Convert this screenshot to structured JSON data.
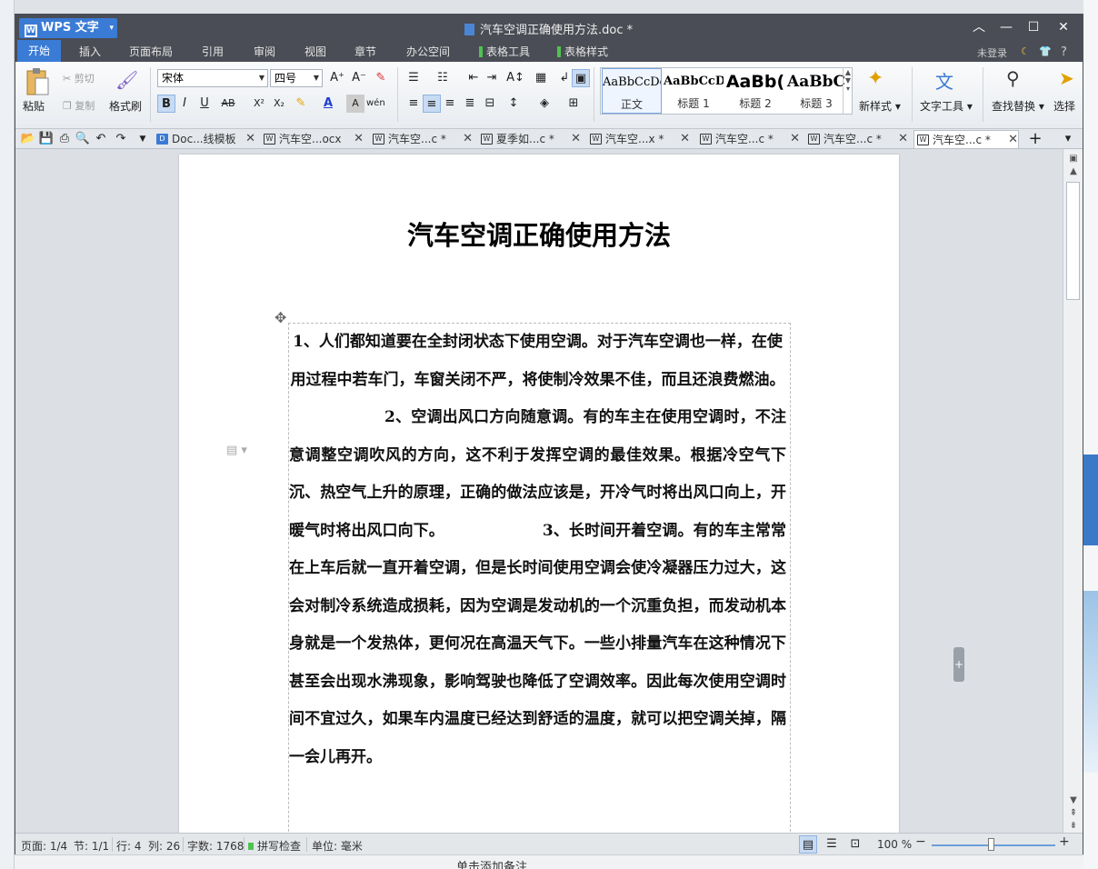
{
  "app": {
    "name": "WPS 文字",
    "doc_title": "汽车空调正确使用方法.doc *"
  },
  "menu": {
    "items": [
      "开始",
      "插入",
      "页面布局",
      "引用",
      "审阅",
      "视图",
      "章节",
      "办公空间"
    ],
    "context_items": [
      "表格工具",
      "表格样式"
    ],
    "login": "未登录",
    "help": "?"
  },
  "ribbon": {
    "paste": "粘贴",
    "cut": "剪切",
    "copy": "复制",
    "format_painter": "格式刷",
    "font_name": "宋体",
    "font_size": "四号",
    "styles": [
      {
        "sample": "AaBbCcDd",
        "name": "正文"
      },
      {
        "sample": "AaBbCcDd",
        "name": "标题 1"
      },
      {
        "sample": "AaBb(",
        "name": "标题 2"
      },
      {
        "sample": "AaBbC",
        "name": "标题 3"
      }
    ],
    "new_style": "新样式",
    "text_tools": "文字工具",
    "find_replace": "查找替换",
    "select": "选择"
  },
  "tabs": [
    {
      "label": "Doc...线模板",
      "icon": "D"
    },
    {
      "label": "汽车空...ocx",
      "icon": "W"
    },
    {
      "label": "汽车空...c *",
      "icon": "W"
    },
    {
      "label": "夏季如...c *",
      "icon": "W"
    },
    {
      "label": "汽车空...x *",
      "icon": "W"
    },
    {
      "label": "汽车空...c *",
      "icon": "W"
    },
    {
      "label": "汽车空...c *",
      "icon": "W"
    },
    {
      "label": "汽车空...c *",
      "icon": "W"
    }
  ],
  "document": {
    "heading": "汽车空调正确使用方法",
    "paragraphs": [
      "1、人们都知道要在全封闭状态下使用空调。对于汽车空调也一样，在使用过程中若车门，车窗关闭不严，将使制冷效果不佳，而且还浪费燃油。",
      "2、空调出风口方向随意调。有的车主在使用空调时，不注意调整空调吹风的方向，这不利于发挥空调的最佳效果。根据冷空气下沉、热空气上升的原理，正确的做法应该是，开冷气时将出风口向上，开暖气时将出风口向下。",
      "3、长时间开着空调。有的车主常常在上车后就一直开着空调，但是长时间使用空调会使冷凝器压力过大，这会对制冷系统造成损耗，因为空调是发动机的一个沉重负担，而发动机本身就是一个发热体，更何况在高温天气下。一些小排量汽车在这种情况下甚至会出现水沸现象，影响驾驶也降低了空调效率。因此每次使用空调时间不宜过久，如果车内温度已经达到舒适的温度，就可以把空调关掉，隔一会儿再开。"
    ]
  },
  "status": {
    "page": "页面: 1/4",
    "section": "节: 1/1",
    "row": "行: 4",
    "col": "列: 26",
    "words": "字数: 1768",
    "spellcheck": "拼写检查",
    "unit": "单位: 毫米",
    "zoom": "100 %"
  },
  "background": {
    "below_text": "单击添加备注"
  },
  "colors": {
    "titlebar": "#4a4d55",
    "accent": "#3a7bd5",
    "context_tab": "#4fc24f"
  }
}
